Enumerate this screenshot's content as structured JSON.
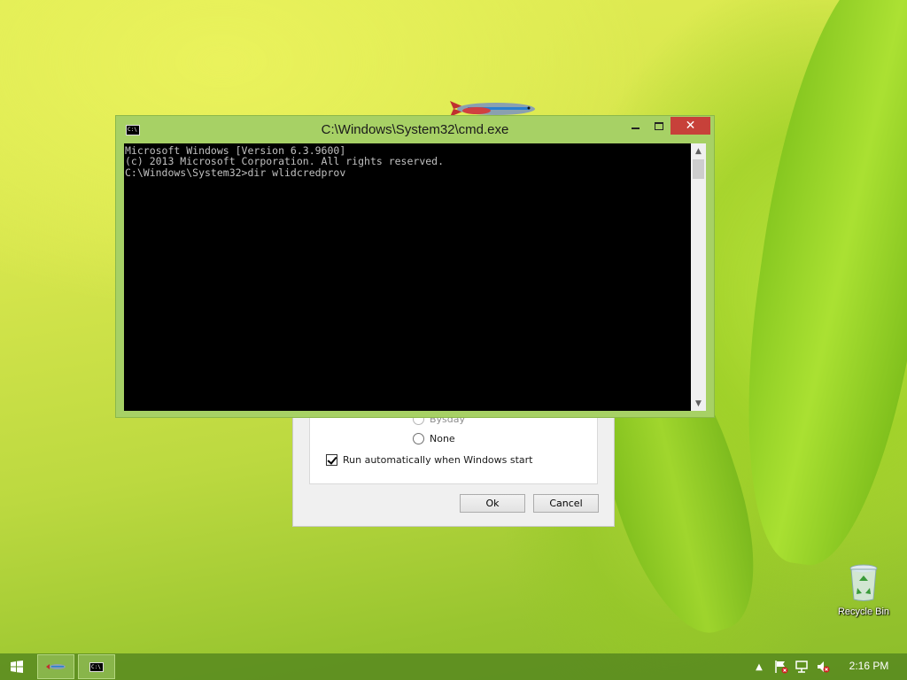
{
  "desktop": {
    "recycle_bin_label": "Recycle Bin"
  },
  "cmd": {
    "title": "C:\\Windows\\System32\\cmd.exe",
    "icon_text": "C:\\",
    "lines": [
      "Microsoft Windows [Version 6.3.9600]",
      "(c) 2013 Microsoft Corporation. All rights reserved.",
      "",
      "C:\\Windows\\System32>dir wlidcredprov"
    ],
    "close_glyph": "✕"
  },
  "dialog": {
    "radio_partial_label": "Bysday",
    "radio_none_label": "None",
    "checkbox_label": "Run automatically when Windows start",
    "checkbox_checked": true,
    "ok_label": "Ok",
    "cancel_label": "Cancel"
  },
  "taskbar": {
    "clock": "2:16 PM",
    "cmd_icon_text": "C:\\"
  },
  "colors": {
    "cmd_frame": "#a7d165",
    "close_button": "#c7413a",
    "taskbar": "#54861e"
  }
}
